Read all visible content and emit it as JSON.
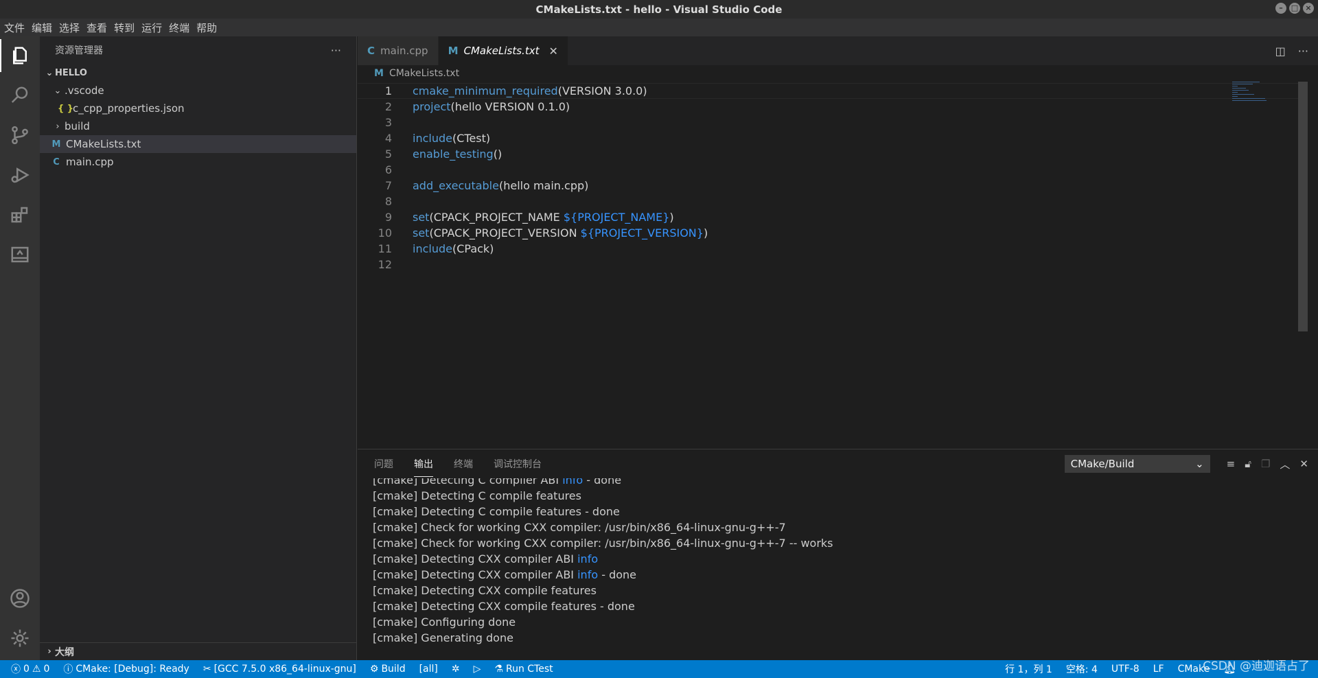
{
  "window": {
    "title": "CMakeLists.txt - hello - Visual Studio Code"
  },
  "menu": [
    "文件",
    "编辑",
    "选择",
    "查看",
    "转到",
    "运行",
    "终端",
    "帮助"
  ],
  "activity_bar": {
    "icons": [
      "files-icon",
      "search-icon",
      "source-control-icon",
      "run-debug-icon",
      "extensions-icon",
      "remote-explorer-icon",
      "account-icon",
      "settings-gear-icon"
    ]
  },
  "sidebar": {
    "title": "资源管理器",
    "more": "···",
    "root": "HELLO",
    "items": [
      {
        "label": ".vscode",
        "kind": "folder-open"
      },
      {
        "label": "c_cpp_properties.json",
        "kind": "json",
        "icon": "{ }"
      },
      {
        "label": "build",
        "kind": "folder-closed"
      },
      {
        "label": "CMakeLists.txt",
        "kind": "cmake",
        "icon": "M"
      },
      {
        "label": "main.cpp",
        "kind": "cpp",
        "icon": "C"
      }
    ],
    "outline": "大纲"
  },
  "tabs": [
    {
      "label": "main.cpp",
      "icon": "C"
    },
    {
      "label": "CMakeLists.txt",
      "icon": "M",
      "close": "✕"
    }
  ],
  "breadcrumb": {
    "icon": "M",
    "file": "CMakeLists.txt"
  },
  "editor": {
    "line_numbers": [
      "1",
      "2",
      "3",
      "4",
      "5",
      "6",
      "7",
      "8",
      "9",
      "10",
      "11",
      "12"
    ],
    "lines": [
      {
        "kw": "cmake_minimum_required",
        "rest": "(VERSION 3.0.0)"
      },
      {
        "kw": "project",
        "rest": "(hello VERSION 0.1.0)"
      },
      {
        "kw": "",
        "rest": ""
      },
      {
        "kw": "include",
        "rest": "(CTest)"
      },
      {
        "kw": "enable_testing",
        "rest": "()"
      },
      {
        "kw": "",
        "rest": ""
      },
      {
        "kw": "add_executable",
        "rest": "(hello main.cpp)"
      },
      {
        "kw": "",
        "rest": ""
      },
      {
        "kw": "set",
        "rest": "(CPACK_PROJECT_NAME ",
        "var": "${PROJECT_NAME}",
        "end": ")"
      },
      {
        "kw": "set",
        "rest": "(CPACK_PROJECT_VERSION ",
        "var": "${PROJECT_VERSION}",
        "end": ")"
      },
      {
        "kw": "include",
        "rest": "(CPack)"
      },
      {
        "kw": "",
        "rest": ""
      }
    ]
  },
  "panel": {
    "tabs": [
      "问题",
      "输出",
      "终端",
      "调试控制台"
    ],
    "channel": "CMake/Build",
    "output": [
      {
        "pre": "[cmake] Detecting C compiler ABI ",
        "hl": "info",
        "post": " - done"
      },
      {
        "pre": "[cmake] Detecting C compile features",
        "hl": "",
        "post": ""
      },
      {
        "pre": "[cmake] Detecting C compile features - done",
        "hl": "",
        "post": ""
      },
      {
        "pre": "[cmake] Check for working CXX compiler: /usr/bin/x86_64-linux-gnu-g++-7",
        "hl": "",
        "post": ""
      },
      {
        "pre": "[cmake] Check for working CXX compiler: /usr/bin/x86_64-linux-gnu-g++-7 -- works",
        "hl": "",
        "post": ""
      },
      {
        "pre": "[cmake] Detecting CXX compiler ABI ",
        "hl": "info",
        "post": ""
      },
      {
        "pre": "[cmake] Detecting CXX compiler ABI ",
        "hl": "info",
        "post": " - done"
      },
      {
        "pre": "[cmake] Detecting CXX compile features",
        "hl": "",
        "post": ""
      },
      {
        "pre": "[cmake] Detecting CXX compile features - done",
        "hl": "",
        "post": ""
      },
      {
        "pre": "[cmake] Configuring done",
        "hl": "",
        "post": ""
      },
      {
        "pre": "[cmake] Generating done",
        "hl": "",
        "post": ""
      }
    ]
  },
  "statusbar": {
    "errors": "0",
    "warnings": "0",
    "cmake_status": "CMake: [Debug]: Ready",
    "kit": "[GCC 7.5.0 x86_64-linux-gnu]",
    "build": "Build",
    "target": "[all]",
    "run_ctest": "Run CTest",
    "position": "行 1，列 1",
    "spaces": "空格: 4",
    "encoding": "UTF-8",
    "eol": "LF",
    "language": "CMake"
  },
  "watermark": "CSDN @迪迦语占了",
  "colors": {
    "accent": "#007acc",
    "keyword": "#569cd6",
    "variable": "#3794ff",
    "cmake_icon": "#519aba",
    "cpp_icon": "#519aba",
    "json_icon": "#cbcb41"
  }
}
